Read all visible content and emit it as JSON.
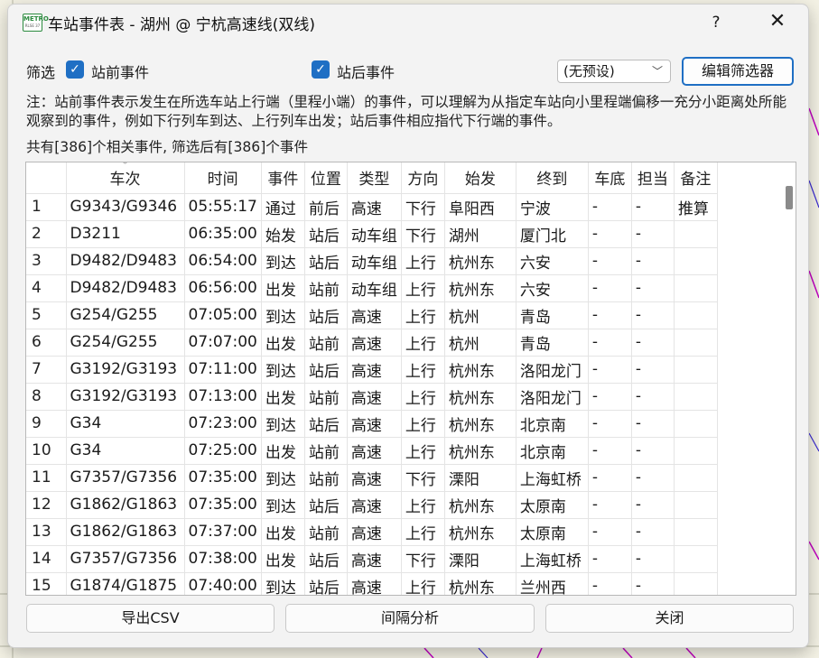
{
  "window": {
    "title": "车站事件表 - 湖州 @ 宁杭高速线(双线)",
    "help_glyph": "?",
    "close_glyph": "✕",
    "icon_text": "METRO",
    "icon_subtext": "RLSE 37"
  },
  "filters": {
    "label": "筛选",
    "before_station": {
      "label": "站前事件",
      "checked": true
    },
    "after_station": {
      "label": "站后事件",
      "checked": true
    },
    "preset": {
      "value": "(无预设)"
    },
    "edit_button": "编辑筛选器"
  },
  "note": "注：站前事件表示发生在所选车站上行端（里程小端）的事件，可以理解为从指定车站向小里程端偏移一充分小距离处所能观察到的事件，例如下行列车到达、上行列车出发；站后事件相应指代下行端的事件。",
  "count_text": "共有[386]个相关事件, 筛选后有[386]个事件",
  "table": {
    "columns": [
      "",
      "车次",
      "时间",
      "事件",
      "位置",
      "类型",
      "方向",
      "始发",
      "终到",
      "车底",
      "担当",
      "备注"
    ],
    "rows": [
      [
        "1",
        "G9343/G9346",
        "05:55:17",
        "通过",
        "前后",
        "高速",
        "下行",
        "阜阳西",
        "宁波",
        "-",
        "-",
        "推算"
      ],
      [
        "2",
        "D3211",
        "06:35:00",
        "始发",
        "站后",
        "动车组",
        "下行",
        "湖州",
        "厦门北",
        "-",
        "-",
        ""
      ],
      [
        "3",
        "D9482/D9483",
        "06:54:00",
        "到达",
        "站后",
        "动车组",
        "上行",
        "杭州东",
        "六安",
        "-",
        "-",
        ""
      ],
      [
        "4",
        "D9482/D9483",
        "06:56:00",
        "出发",
        "站前",
        "动车组",
        "上行",
        "杭州东",
        "六安",
        "-",
        "-",
        ""
      ],
      [
        "5",
        "G254/G255",
        "07:05:00",
        "到达",
        "站后",
        "高速",
        "上行",
        "杭州",
        "青岛",
        "-",
        "-",
        ""
      ],
      [
        "6",
        "G254/G255",
        "07:07:00",
        "出发",
        "站前",
        "高速",
        "上行",
        "杭州",
        "青岛",
        "-",
        "-",
        ""
      ],
      [
        "7",
        "G3192/G3193",
        "07:11:00",
        "到达",
        "站后",
        "高速",
        "上行",
        "杭州东",
        "洛阳龙门",
        "-",
        "-",
        ""
      ],
      [
        "8",
        "G3192/G3193",
        "07:13:00",
        "出发",
        "站前",
        "高速",
        "上行",
        "杭州东",
        "洛阳龙门",
        "-",
        "-",
        ""
      ],
      [
        "9",
        "G34",
        "07:23:00",
        "到达",
        "站后",
        "高速",
        "上行",
        "杭州东",
        "北京南",
        "-",
        "-",
        ""
      ],
      [
        "10",
        "G34",
        "07:25:00",
        "出发",
        "站前",
        "高速",
        "上行",
        "杭州东",
        "北京南",
        "-",
        "-",
        ""
      ],
      [
        "11",
        "G7357/G7356",
        "07:35:00",
        "到达",
        "站前",
        "高速",
        "下行",
        "溧阳",
        "上海虹桥",
        "-",
        "-",
        ""
      ],
      [
        "12",
        "G1862/G1863",
        "07:35:00",
        "到达",
        "站后",
        "高速",
        "上行",
        "杭州东",
        "太原南",
        "-",
        "-",
        ""
      ],
      [
        "13",
        "G1862/G1863",
        "07:37:00",
        "出发",
        "站前",
        "高速",
        "上行",
        "杭州东",
        "太原南",
        "-",
        "-",
        ""
      ],
      [
        "14",
        "G7357/G7356",
        "07:38:00",
        "出发",
        "站后",
        "高速",
        "下行",
        "溧阳",
        "上海虹桥",
        "-",
        "-",
        ""
      ],
      [
        "15",
        "G1874/G1875",
        "07:40:00",
        "到达",
        "站后",
        "高速",
        "上行",
        "杭州东",
        "兰州西",
        "-",
        "-",
        ""
      ]
    ]
  },
  "buttons": {
    "export": "导出CSV",
    "interval": "间隔分析",
    "close": "关闭"
  },
  "colors": {
    "accent": "#1f6fc4",
    "background_lines": "#c000c0"
  }
}
